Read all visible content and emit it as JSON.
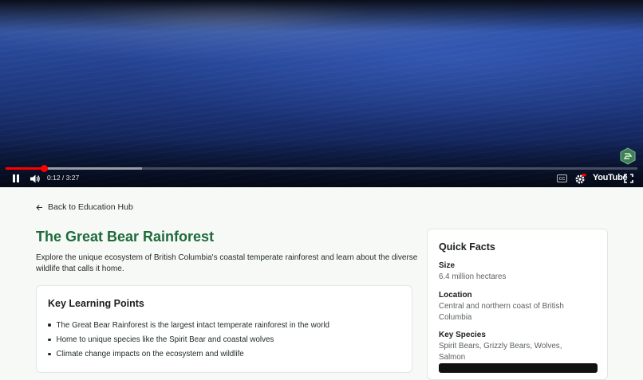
{
  "player": {
    "time": "0:12 / 3:27",
    "progress_played_fraction": 0.06,
    "progress_buffered_fraction": 0.216,
    "brand_label": "YouTube",
    "accent_color": "#ff0000",
    "icons": [
      "pause-icon",
      "volume-icon",
      "captions-icon",
      "settings-icon",
      "fullscreen-icon",
      "channel-logo-icon"
    ]
  },
  "nav": {
    "back_label": "Back to Education Hub"
  },
  "article": {
    "title": "The Great Bear Rainforest",
    "title_color": "#1e6b3a",
    "intro": "Explore the unique ecosystem of British Columbia's coastal temperate rainforest and learn about the diverse wildlife that calls it home."
  },
  "learning": {
    "heading": "Key Learning Points",
    "points": [
      "The Great Bear Rainforest is the largest intact temperate rainforest in the world",
      "Home to unique species like the Spirit Bear and coastal wolves",
      "Climate change impacts on the ecosystem and wildlife"
    ]
  },
  "facts": {
    "heading": "Quick Facts",
    "items": [
      {
        "label": "Size",
        "value": "6.4 million hectares"
      },
      {
        "label": "Location",
        "value": "Central and northern coast of British Columbia"
      },
      {
        "label": "Key Species",
        "value": "Spirit Bears, Grizzly Bears, Wolves, Salmon"
      }
    ]
  }
}
